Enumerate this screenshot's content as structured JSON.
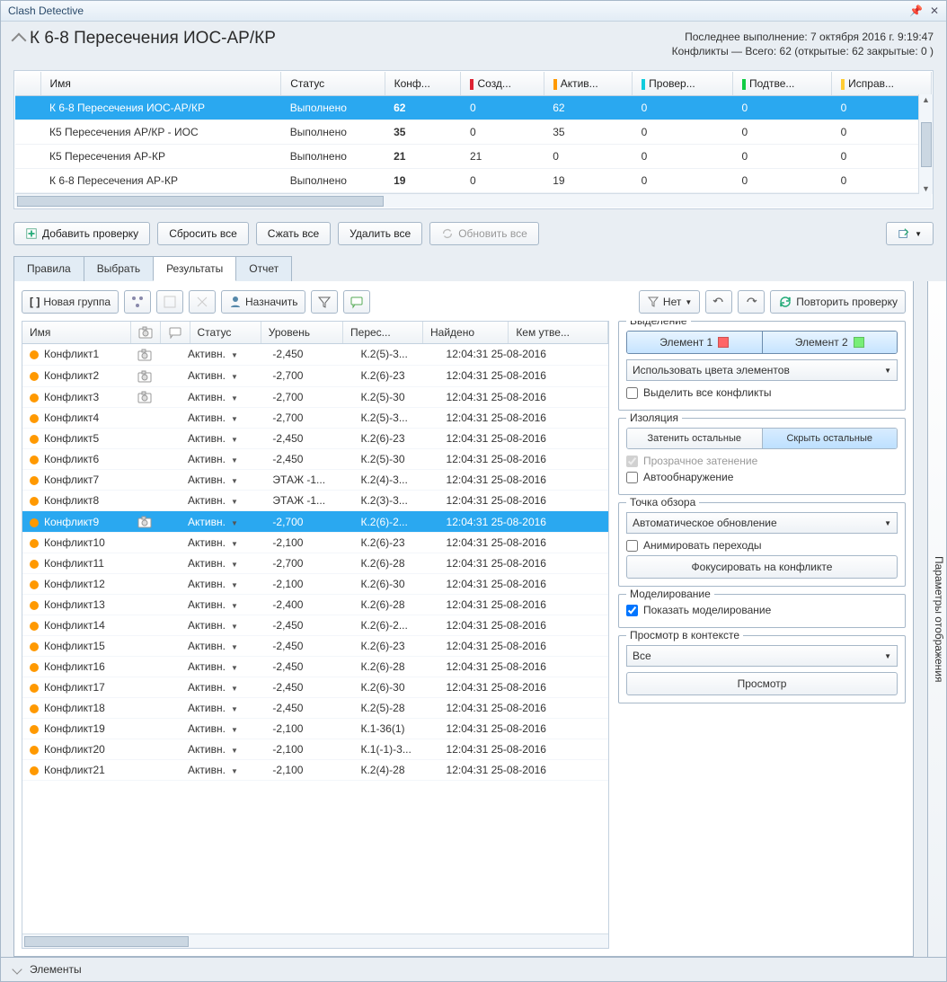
{
  "window": {
    "title": "Clash Detective"
  },
  "header": {
    "title": "К 6-8 Пересечения ИОС-АР/КР",
    "last_run_label": "Последнее выполнение:",
    "last_run_value": "7 октября 2016 г. 9:19:47",
    "summary": "Конфликты — Всего: 62 (открытые: 62 закрытые: 0 )"
  },
  "tests": {
    "columns": [
      "Имя",
      "Статус",
      "Конф...",
      "Созд...",
      "Актив...",
      "Провер...",
      "Подтве...",
      "Исправ..."
    ],
    "rows": [
      {
        "name": "К 6-8 Пересечения ИОС-АР/КР",
        "status": "Выполнено",
        "conf": "62",
        "new": "0",
        "active": "62",
        "rev": "0",
        "appr": "0",
        "res": "0",
        "selected": true
      },
      {
        "name": "К5 Пересечения АР/КР - ИОС",
        "status": "Выполнено",
        "conf": "35",
        "new": "0",
        "active": "35",
        "rev": "0",
        "appr": "0",
        "res": "0"
      },
      {
        "name": "К5 Пересечения АР-КР",
        "status": "Выполнено",
        "conf": "21",
        "new": "21",
        "active": "0",
        "rev": "0",
        "appr": "0",
        "res": "0"
      },
      {
        "name": "К 6-8 Пересечения АР-КР",
        "status": "Выполнено",
        "conf": "19",
        "new": "0",
        "active": "19",
        "rev": "0",
        "appr": "0",
        "res": "0"
      }
    ]
  },
  "buttons": {
    "add_test": "Добавить проверку",
    "reset_all": "Сбросить все",
    "compact_all": "Сжать все",
    "delete_all": "Удалить все",
    "update_all": "Обновить все"
  },
  "tabs": [
    "Правила",
    "Выбрать",
    "Результаты",
    "Отчет"
  ],
  "active_tab": 2,
  "results_toolbar": {
    "new_group": "Новая группа",
    "assign": "Назначить",
    "none": "Нет",
    "rerun": "Повторить проверку"
  },
  "results": {
    "columns": [
      "Имя",
      "",
      "",
      "Статус",
      "Уровень",
      "Перес...",
      "Найдено",
      "Кем утве..."
    ],
    "rows": [
      {
        "name": "Конфликт1",
        "cam": true,
        "status": "Активн.",
        "level": "-2,450",
        "grid": "К.2(5)-3...",
        "found": "12:04:31 25-08-2016"
      },
      {
        "name": "Конфликт2",
        "cam": true,
        "status": "Активн.",
        "level": "-2,700",
        "grid": "К.2(6)-23",
        "found": "12:04:31 25-08-2016"
      },
      {
        "name": "Конфликт3",
        "cam": true,
        "status": "Активн.",
        "level": "-2,700",
        "grid": "К.2(5)-30",
        "found": "12:04:31 25-08-2016"
      },
      {
        "name": "Конфликт4",
        "status": "Активн.",
        "level": "-2,700",
        "grid": "К.2(5)-3...",
        "found": "12:04:31 25-08-2016"
      },
      {
        "name": "Конфликт5",
        "status": "Активн.",
        "level": "-2,450",
        "grid": "К.2(6)-23",
        "found": "12:04:31 25-08-2016"
      },
      {
        "name": "Конфликт6",
        "status": "Активн.",
        "level": "-2,450",
        "grid": "К.2(5)-30",
        "found": "12:04:31 25-08-2016"
      },
      {
        "name": "Конфликт7",
        "status": "Активн.",
        "level": "ЭТАЖ -1...",
        "grid": "К.2(4)-3...",
        "found": "12:04:31 25-08-2016"
      },
      {
        "name": "Конфликт8",
        "status": "Активн.",
        "level": "ЭТАЖ -1...",
        "grid": "К.2(3)-3...",
        "found": "12:04:31 25-08-2016"
      },
      {
        "name": "Конфликт9",
        "cam": true,
        "status": "Активн.",
        "level": "-2,700",
        "grid": "К.2(6)-2...",
        "found": "12:04:31 25-08-2016",
        "selected": true
      },
      {
        "name": "Конфликт10",
        "status": "Активн.",
        "level": "-2,100",
        "grid": "К.2(6)-23",
        "found": "12:04:31 25-08-2016"
      },
      {
        "name": "Конфликт11",
        "status": "Активн.",
        "level": "-2,700",
        "grid": "К.2(6)-28",
        "found": "12:04:31 25-08-2016"
      },
      {
        "name": "Конфликт12",
        "status": "Активн.",
        "level": "-2,100",
        "grid": "К.2(6)-30",
        "found": "12:04:31 25-08-2016"
      },
      {
        "name": "Конфликт13",
        "status": "Активн.",
        "level": "-2,400",
        "grid": "К.2(6)-28",
        "found": "12:04:31 25-08-2016"
      },
      {
        "name": "Конфликт14",
        "status": "Активн.",
        "level": "-2,450",
        "grid": "К.2(6)-2...",
        "found": "12:04:31 25-08-2016"
      },
      {
        "name": "Конфликт15",
        "status": "Активн.",
        "level": "-2,450",
        "grid": "К.2(6)-23",
        "found": "12:04:31 25-08-2016"
      },
      {
        "name": "Конфликт16",
        "status": "Активн.",
        "level": "-2,450",
        "grid": "К.2(6)-28",
        "found": "12:04:31 25-08-2016"
      },
      {
        "name": "Конфликт17",
        "status": "Активн.",
        "level": "-2,450",
        "grid": "К.2(6)-30",
        "found": "12:04:31 25-08-2016"
      },
      {
        "name": "Конфликт18",
        "status": "Активн.",
        "level": "-2,450",
        "grid": "К.2(5)-28",
        "found": "12:04:31 25-08-2016"
      },
      {
        "name": "Конфликт19",
        "status": "Активн.",
        "level": "-2,100",
        "grid": "К.1-36(1)",
        "found": "12:04:31 25-08-2016"
      },
      {
        "name": "Конфликт20",
        "status": "Активн.",
        "level": "-2,100",
        "grid": "К.1(-1)-3...",
        "found": "12:04:31 25-08-2016"
      },
      {
        "name": "Конфликт21",
        "status": "Активн.",
        "level": "-2,100",
        "grid": "К.2(4)-28",
        "found": "12:04:31 25-08-2016"
      }
    ]
  },
  "side": {
    "highlight": {
      "title": "Выделение",
      "item1": "Элемент 1",
      "item2": "Элемент 2",
      "use_colors": "Использовать цвета элементов",
      "highlight_all": "Выделить все конфликты"
    },
    "isolation": {
      "title": "Изоляция",
      "dim": "Затенить остальные",
      "hide": "Скрыть остальные",
      "transparent": "Прозрачное затенение",
      "auto": "Автообнаружение"
    },
    "viewpoint": {
      "title": "Точка обзора",
      "mode": "Автоматическое обновление",
      "animate": "Анимировать переходы",
      "focus": "Фокусировать на конфликте"
    },
    "simulation": {
      "title": "Моделирование",
      "show": "Показать моделирование"
    },
    "context": {
      "title": "Просмотр в контексте",
      "all": "Все",
      "view": "Просмотр"
    },
    "side_tab": "Параметры отображения"
  },
  "bottom": {
    "items": "Элементы"
  }
}
